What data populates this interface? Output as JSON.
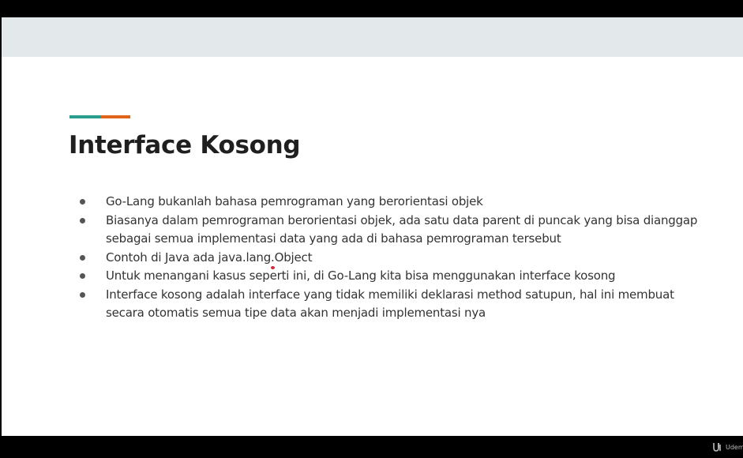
{
  "slide": {
    "title": "Interface Kosong",
    "accent_colors": [
      "#2a9d8f",
      "#e0631a"
    ],
    "bullets": [
      {
        "text": "Go-Lang bukanlah bahasa pemrograman yang berorientasi objek"
      },
      {
        "text": "Biasanya dalam pemrograman berorientasi objek, ada satu data parent di puncak yang bisa dianggap sebagai semua implementasi data yang ada di bahasa pemrograman tersebut"
      },
      {
        "text": "Contoh di Java ada java.lang.Object"
      },
      {
        "text": "Untuk menangani kasus seperti ini, di Go-Lang kita bisa menggunakan interface kosong"
      },
      {
        "text": "Interface kosong adalah interface yang tidak memiliki deklarasi method satupun, hal ini membuat secara otomatis semua tipe data akan menjadi implementasi nya"
      }
    ]
  },
  "watermark": {
    "logo_icon": "udemy-logo-icon",
    "text": "Udemy"
  }
}
